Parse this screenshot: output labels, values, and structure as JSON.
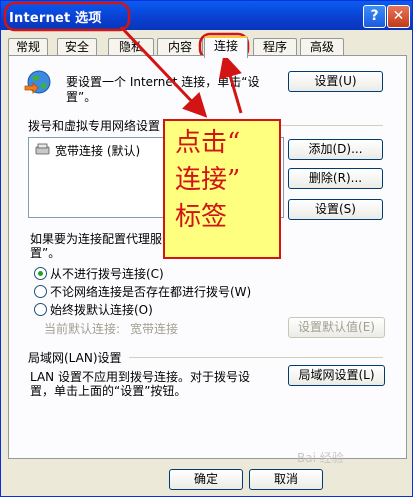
{
  "window": {
    "title": "Internet 选项",
    "help_glyph": "?",
    "close_glyph": "✕"
  },
  "tabs": [
    {
      "label": "常规"
    },
    {
      "label": "安全"
    },
    {
      "label": "隐私"
    },
    {
      "label": "内容"
    },
    {
      "label": "连接",
      "active": true
    },
    {
      "label": "程序"
    },
    {
      "label": "高级"
    }
  ],
  "setup": {
    "text_line1": "要设置一个 Internet 连接，单击“设",
    "text_line2": "置”。",
    "button": "设置(U)"
  },
  "dialup": {
    "group_label": "拨号和虚拟专用网络设置",
    "items": [
      {
        "label": "宽带连接 (默认)",
        "icon": "broadband-icon"
      }
    ],
    "add_button": "添加(D)...",
    "remove_button": "删除(R)...",
    "settings_button": "设置(S)"
  },
  "proxy_note": {
    "line1": "如果要为连接配置代理服",
    "line2": "置”。"
  },
  "radios": [
    {
      "label": "从不进行拨号连接(C)",
      "selected": true
    },
    {
      "label": "不论网络连接是否存在都进行拨号(W)",
      "selected": false
    },
    {
      "label": "始终拨默认连接(O)",
      "selected": false
    }
  ],
  "default_connection": {
    "label": "当前默认连接:",
    "value": "宽带连接",
    "button": "设置默认值(E)"
  },
  "lan": {
    "group_label": "局域网(LAN)设置",
    "text_line1": "LAN 设置不应用到拨号连接。对于拨号设",
    "text_line2": "置，单击上面的“设置”按钮。",
    "button": "局域网设置(L)"
  },
  "callout": {
    "text": "点击“\n连接”\n标签"
  },
  "bottom_buttons": {
    "ok": "确定",
    "cancel": "取消"
  },
  "watermark": "Bai 经验",
  "colors": {
    "accent_red": "#D21414",
    "callout_bg": "#FFFF7F",
    "titlebar_blue": "#0A3FD0"
  }
}
